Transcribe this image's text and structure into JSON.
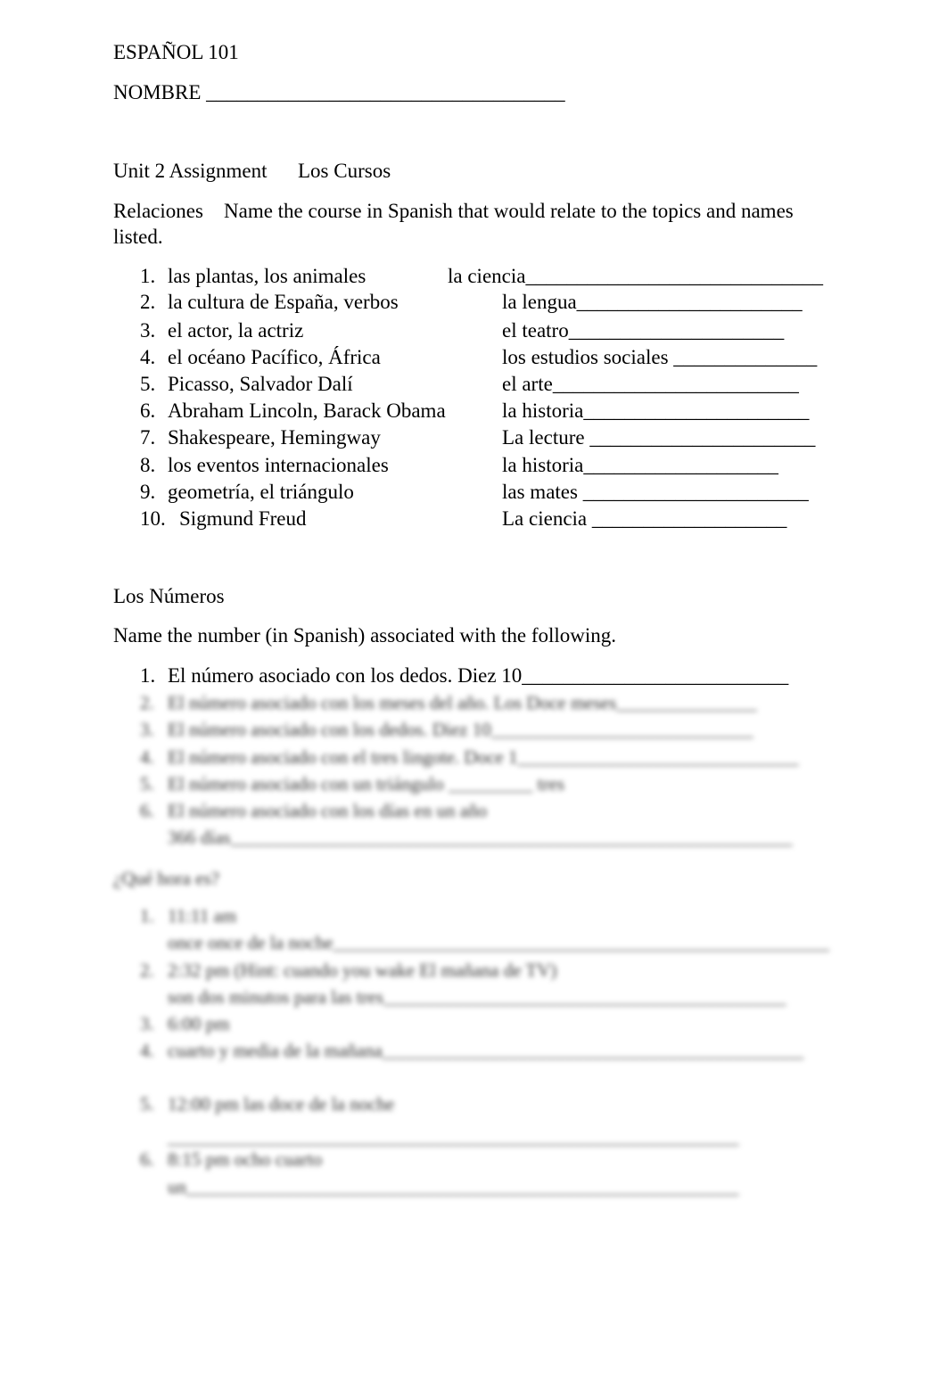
{
  "header": {
    "course": "ESPAÑOL 101",
    "name_label": "NOMBRE ___________________________________"
  },
  "assignment": {
    "title": "Unit 2 Assignment",
    "subtitle": "Los Cursos"
  },
  "relaciones": {
    "label": "Relaciones",
    "instructions_1": "Name the course in Spanish that would relate to the topics and names",
    "instructions_2": "listed.",
    "items": [
      {
        "num": "1.",
        "topic": "las plantas, los animales",
        "answer": "la ciencia_____________________________"
      },
      {
        "num": "2.",
        "topic": "la cultura de España, verbos",
        "answer": "la lengua______________________"
      },
      {
        "num": "3.",
        "topic": "el actor, la actriz",
        "answer": "el teatro_____________________"
      },
      {
        "num": "4.",
        "topic": "el océano Pacífico, África",
        "answer": "los estudios sociales ______________"
      },
      {
        "num": "5.",
        "topic": "Picasso, Salvador Dalí",
        "answer": "el arte________________________"
      },
      {
        "num": "6.",
        "topic": "Abraham Lincoln, Barack Obama",
        "answer": "la historia______________________"
      },
      {
        "num": "7.",
        "topic": "Shakespeare, Hemingway",
        "answer": "La lecture ______________________"
      },
      {
        "num": "8.",
        "topic": "los eventos internacionales",
        "answer": "la historia___________________"
      },
      {
        "num": "9.",
        "topic": "geometría, el triángulo",
        "answer": "las mates ______________________"
      },
      {
        "num": "10.",
        "topic": "Sigmund Freud",
        "answer": "La ciencia ___________________"
      }
    ]
  },
  "numeros": {
    "title": "Los Números",
    "instructions": "Name the number (in Spanish) associated with the following.",
    "item_1": {
      "num": "1.",
      "text": "El número asociado con los dedos. Diez 10__________________________"
    },
    "blurred_items": [
      {
        "num": "2.",
        "text": "El número asociado con los meses del año. Los Doce meses_______________"
      },
      {
        "num": "3.",
        "text": "El número asociado con los dedos.    Diez 10____________________________"
      },
      {
        "num": "4.",
        "text": "El número asociado con el tres lingote. Doce 1______________________________"
      },
      {
        "num": "5.",
        "text": "El número asociado con un triángulo _________ tres"
      },
      {
        "num": "6.",
        "text": "El número asociado con los días en un año"
      },
      {
        "num": "",
        "text": "366 días____________________________________________________________"
      }
    ]
  },
  "hora": {
    "title": "¿Qué hora es?",
    "blurred_items": [
      {
        "num": "1.",
        "text": "11:11 am"
      },
      {
        "num": "",
        "text": "once once de la  noche_____________________________________________________"
      },
      {
        "num": "2.",
        "text": "2:32 pm (Hint: cuando you wake El mañana de TV)"
      },
      {
        "num": "",
        "text": " son dos minutos para las tres___________________________________________"
      },
      {
        "num": "3.",
        "text": "6:00 pm"
      },
      {
        "num": "4.",
        "text": " cuarto y media de la mañana_____________________________________________"
      },
      {
        "num": "5.",
        "text": "12:00 pm  las doce de la noche"
      },
      {
        "num": "",
        "text": "_____________________________________________________________"
      },
      {
        "num": "6.",
        "text": "8:15 pm  ocho cuarto"
      },
      {
        "num": "",
        "text": "un___________________________________________________________"
      }
    ]
  }
}
